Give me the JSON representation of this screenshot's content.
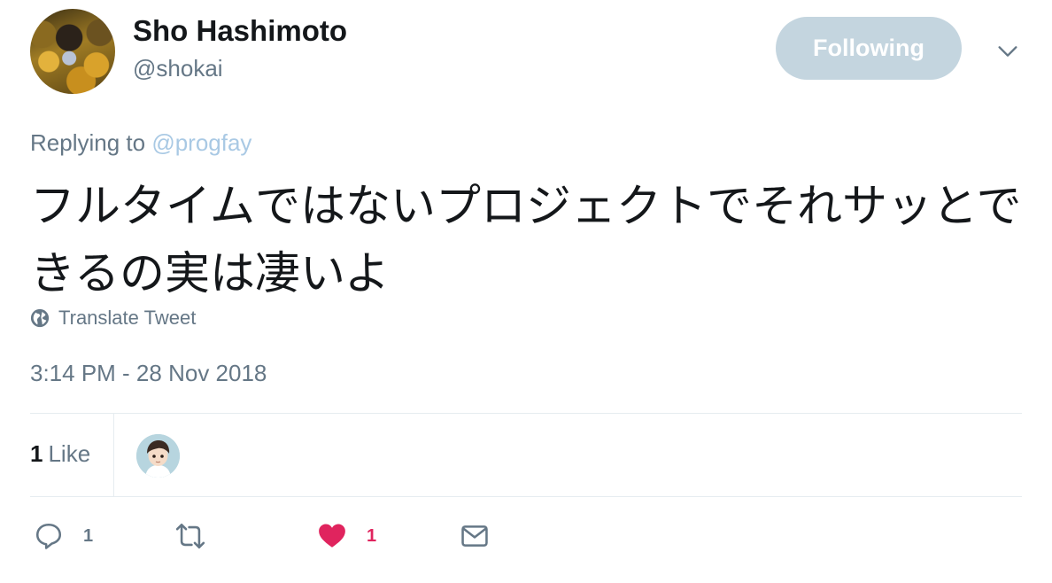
{
  "author": {
    "name": "Sho Hashimoto",
    "handle": "@shokai"
  },
  "follow_button": {
    "label": "Following"
  },
  "reply_context": {
    "prefix": "Replying to",
    "mention": "@progfay"
  },
  "tweet": {
    "text": "フルタイムではないプロジェクトでそれサッとできるの実は凄いよ",
    "translate_label": "Translate Tweet",
    "timestamp": "3:14 PM - 28 Nov 2018"
  },
  "stats": {
    "like_count": "1",
    "like_label": "Like"
  },
  "actions": {
    "reply_count": "1",
    "like_count": "1"
  },
  "icons": {
    "chevron": "chevron-down-icon",
    "globe": "globe-icon",
    "reply": "reply-icon",
    "retweet": "retweet-icon",
    "like": "heart-icon",
    "dm": "envelope-icon"
  },
  "colors": {
    "secondary_text": "#657786",
    "follow_button_bg": "#c4d5df",
    "mention": "#a9c9e4",
    "like": "#e0245e"
  }
}
